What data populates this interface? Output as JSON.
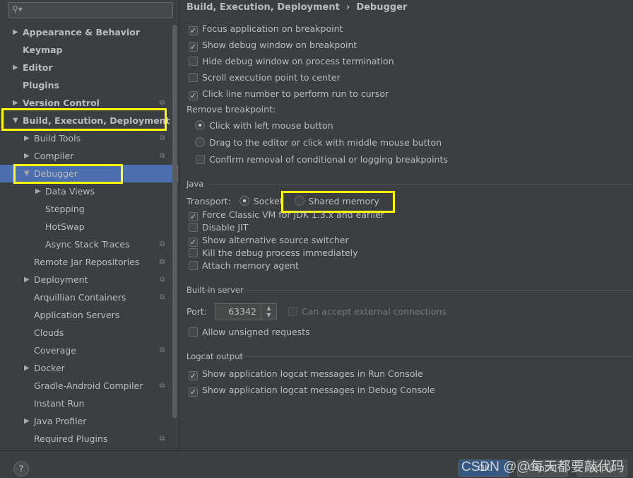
{
  "search": {
    "placeholder": "",
    "icon": "search-icon"
  },
  "sidebar": {
    "items": [
      {
        "label": "Appearance & Behavior",
        "level": 0,
        "arrow": "right",
        "bold": true
      },
      {
        "label": "Keymap",
        "level": 0,
        "arrow": "",
        "bold": true
      },
      {
        "label": "Editor",
        "level": 0,
        "arrow": "right",
        "bold": true
      },
      {
        "label": "Plugins",
        "level": 0,
        "arrow": "",
        "bold": true
      },
      {
        "label": "Version Control",
        "level": 0,
        "arrow": "right",
        "bold": true,
        "copy": true
      },
      {
        "label": "Build, Execution, Deployment",
        "level": 0,
        "arrow": "down",
        "bold": true
      },
      {
        "label": "Build Tools",
        "level": 1,
        "arrow": "right",
        "copy": true
      },
      {
        "label": "Compiler",
        "level": 1,
        "arrow": "right",
        "copy": true
      },
      {
        "label": "Debugger",
        "level": 1,
        "arrow": "down",
        "selected": true
      },
      {
        "label": "Data Views",
        "level": 2,
        "arrow": "right"
      },
      {
        "label": "Stepping",
        "level": 2,
        "arrow": ""
      },
      {
        "label": "HotSwap",
        "level": 2,
        "arrow": ""
      },
      {
        "label": "Async Stack Traces",
        "level": 2,
        "arrow": "",
        "copy": true
      },
      {
        "label": "Remote Jar Repositories",
        "level": 1,
        "arrow": "",
        "copy": true
      },
      {
        "label": "Deployment",
        "level": 1,
        "arrow": "right",
        "copy": true
      },
      {
        "label": "Arquillian Containers",
        "level": 1,
        "arrow": "",
        "copy": true
      },
      {
        "label": "Application Servers",
        "level": 1,
        "arrow": ""
      },
      {
        "label": "Clouds",
        "level": 1,
        "arrow": ""
      },
      {
        "label": "Coverage",
        "level": 1,
        "arrow": "",
        "copy": true
      },
      {
        "label": "Docker",
        "level": 1,
        "arrow": "right"
      },
      {
        "label": "Gradle-Android Compiler",
        "level": 1,
        "arrow": "",
        "copy": true
      },
      {
        "label": "Instant Run",
        "level": 1,
        "arrow": ""
      },
      {
        "label": "Java Profiler",
        "level": 1,
        "arrow": "right"
      },
      {
        "label": "Required Plugins",
        "level": 1,
        "arrow": "",
        "copy": true
      }
    ]
  },
  "breadcrumb": {
    "parent": "Build, Execution, Deployment",
    "sep": "›",
    "current": "Debugger"
  },
  "general": [
    {
      "label": "Focus application on breakpoint",
      "checked": true
    },
    {
      "label": "Show debug window on breakpoint",
      "checked": true
    },
    {
      "label": "Hide debug window on process termination",
      "checked": false
    },
    {
      "label": "Scroll execution point to center",
      "checked": false
    },
    {
      "label": "Click line number to perform run to cursor",
      "checked": true
    }
  ],
  "remove_breakpoint": {
    "label": "Remove breakpoint:",
    "options": [
      {
        "label": "Click with left mouse button",
        "selected": true
      },
      {
        "label": "Drag to the editor or click with middle mouse button",
        "selected": false
      }
    ],
    "confirm": {
      "label": "Confirm removal of conditional or logging breakpoints",
      "checked": false
    }
  },
  "java": {
    "title": "Java",
    "transport_label": "Transport:",
    "socket": "Socket",
    "shared_memory": "Shared memory",
    "transport_selected": "Socket",
    "options": [
      {
        "label": "Force Classic VM for JDK 1.3.x and earlier",
        "checked": true
      },
      {
        "label": "Disable JIT",
        "checked": false
      },
      {
        "label": "Show alternative source switcher",
        "checked": true
      },
      {
        "label": "Kill the debug process immediately",
        "checked": false
      },
      {
        "label": "Attach memory agent",
        "checked": false
      }
    ]
  },
  "server": {
    "title": "Built-in server",
    "port_label": "Port:",
    "port": "63342",
    "external": "Can accept external connections",
    "external_checked": false,
    "unsigned": "Allow unsigned requests",
    "unsigned_checked": false
  },
  "logcat": {
    "title": "Logcat output",
    "options": [
      {
        "label": "Show application logcat messages in Run Console",
        "checked": true
      },
      {
        "label": "Show application logcat messages in Debug Console",
        "checked": true
      }
    ]
  },
  "footer": {
    "help": "?",
    "ok": "OK",
    "cancel": "Cancel",
    "apply": "Apply"
  },
  "watermark": "CSDN @@每天都要敲代码",
  "colors": {
    "selection": "#4b6eaf",
    "highlight": "#ffff00",
    "background": "#3c3f41"
  }
}
